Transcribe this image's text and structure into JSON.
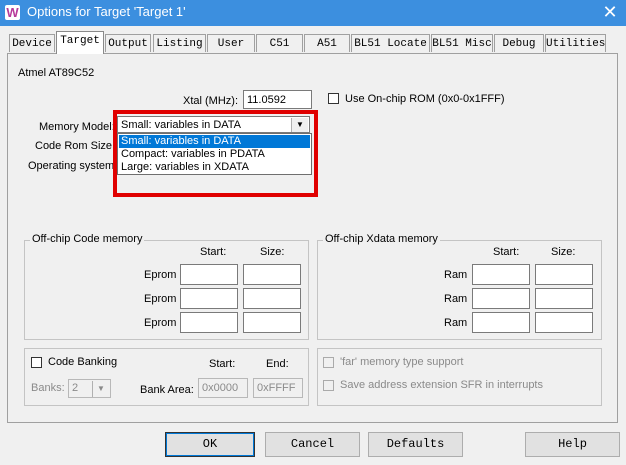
{
  "window": {
    "title": "Options for Target 'Target 1'",
    "logo": "W",
    "close": "✕"
  },
  "tabs": [
    "Device",
    "Target",
    "Output",
    "Listing",
    "User",
    "C51",
    "A51",
    "BL51 Locate",
    "BL51 Misc",
    "Debug",
    "Utilities"
  ],
  "active_tab": "Target",
  "target": {
    "device_name": "Atmel AT89C52",
    "xtal_label": "Xtal (MHz):",
    "xtal_value": "11.0592",
    "onchip_rom_label": "Use On-chip ROM (0x0-0x1FFF)",
    "memory_model_label": "Memory Model:",
    "memory_model_value": "Small: variables in DATA",
    "memory_model_options": [
      "Small: variables in DATA",
      "Compact: variables in PDATA",
      "Large: variables in XDATA"
    ],
    "code_rom_size_label": "Code Rom Size:",
    "operating_system_label": "Operating system:"
  },
  "offchip_code": {
    "title": "Off-chip Code memory",
    "start_header": "Start:",
    "size_header": "Size:",
    "rows": [
      "Eprom",
      "Eprom",
      "Eprom"
    ]
  },
  "offchip_xdata": {
    "title": "Off-chip Xdata memory",
    "start_header": "Start:",
    "size_header": "Size:",
    "rows": [
      "Ram",
      "Ram",
      "Ram"
    ]
  },
  "banking": {
    "code_banking_label": "Code Banking",
    "start_header": "Start:",
    "end_header": "End:",
    "banks_label": "Banks:",
    "banks_value": "2",
    "bank_area_label": "Bank Area:",
    "bank_area_start": "0x0000",
    "bank_area_end": "0xFFFF",
    "far_label": "'far' memory type support",
    "sfr_label": "Save address extension SFR in interrupts"
  },
  "buttons": {
    "ok": "OK",
    "cancel": "Cancel",
    "defaults": "Defaults",
    "help": "Help"
  }
}
